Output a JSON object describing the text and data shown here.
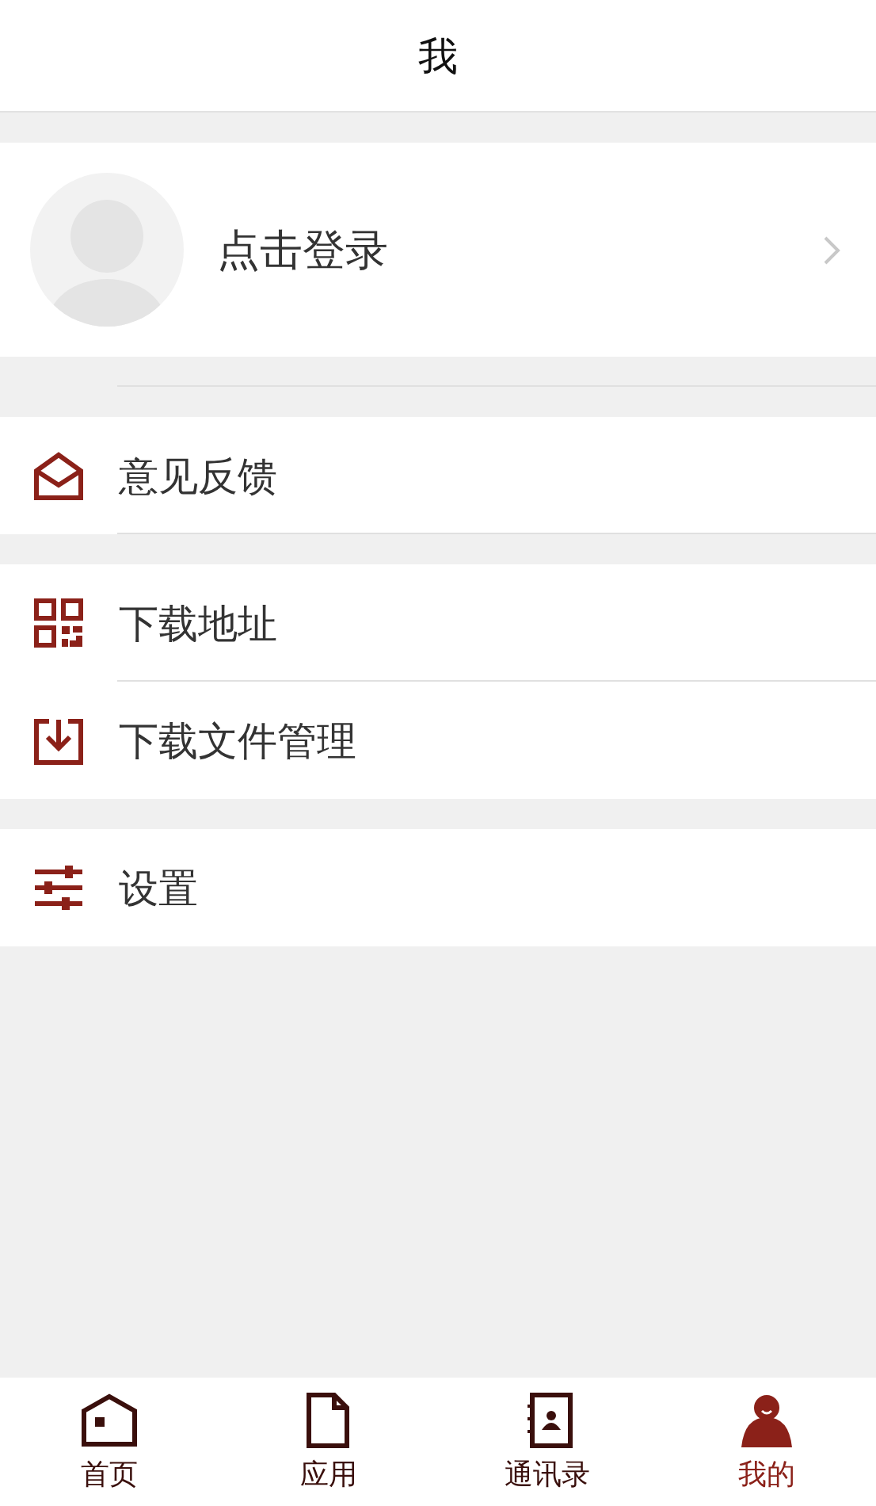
{
  "header": {
    "title": "我"
  },
  "profile": {
    "label": "点击登录"
  },
  "groups": [
    {
      "items": [
        {
          "kind": "feedback",
          "label": "意见反馈"
        }
      ]
    },
    {
      "items": [
        {
          "kind": "qrcode",
          "label": "下载地址"
        },
        {
          "kind": "download",
          "label": "下载文件管理"
        }
      ]
    },
    {
      "items": [
        {
          "kind": "settings",
          "label": "设置"
        }
      ]
    }
  ],
  "tabs": [
    {
      "kind": "home",
      "label": "首页",
      "selected": false
    },
    {
      "kind": "apps",
      "label": "应用",
      "selected": false
    },
    {
      "kind": "contacts",
      "label": "通讯录",
      "selected": false
    },
    {
      "kind": "me",
      "label": "我的",
      "selected": true
    }
  ]
}
